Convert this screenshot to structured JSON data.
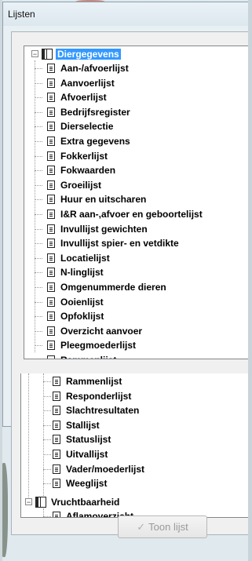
{
  "window": {
    "title": "Lijsten"
  },
  "tree_upper": {
    "root_label": "Diergegevens",
    "items": [
      "Aan-/afvoerlijst",
      "Aanvoerlijst",
      "Afvoerlijst",
      "Bedrijfsregister",
      "Dierselectie",
      "Extra gegevens",
      "Fokkerlijst",
      "Fokwaarden",
      "Groeilijst",
      "Huur en uitscharen",
      "I&R aan-,afvoer en geboortelijst",
      "Invullijst gewichten",
      "Invullijst spier- en vetdikte",
      "Locatielijst",
      "N-linglijst",
      "Omgenummerde dieren",
      "Ooienlijst",
      "Opfoklijst",
      "Overzicht aanvoer",
      "Pleegmoederlijst",
      "Rammenlijst"
    ]
  },
  "tree_lower": {
    "items": [
      "Rammenlijst",
      "Responderlijst",
      "Slachtresultaten",
      "Stallijst",
      "Statuslijst",
      "Uitvallijst",
      "Vader/moederlijst",
      "Weeglijst"
    ],
    "group_label": "Vruchtbaarheid",
    "group_items": [
      "Aflamoverzicht"
    ]
  },
  "buttons": {
    "show_list": "Toon lijst"
  },
  "colors": {
    "selection": "#3399ff",
    "window_bg": "#e8f0f4"
  }
}
